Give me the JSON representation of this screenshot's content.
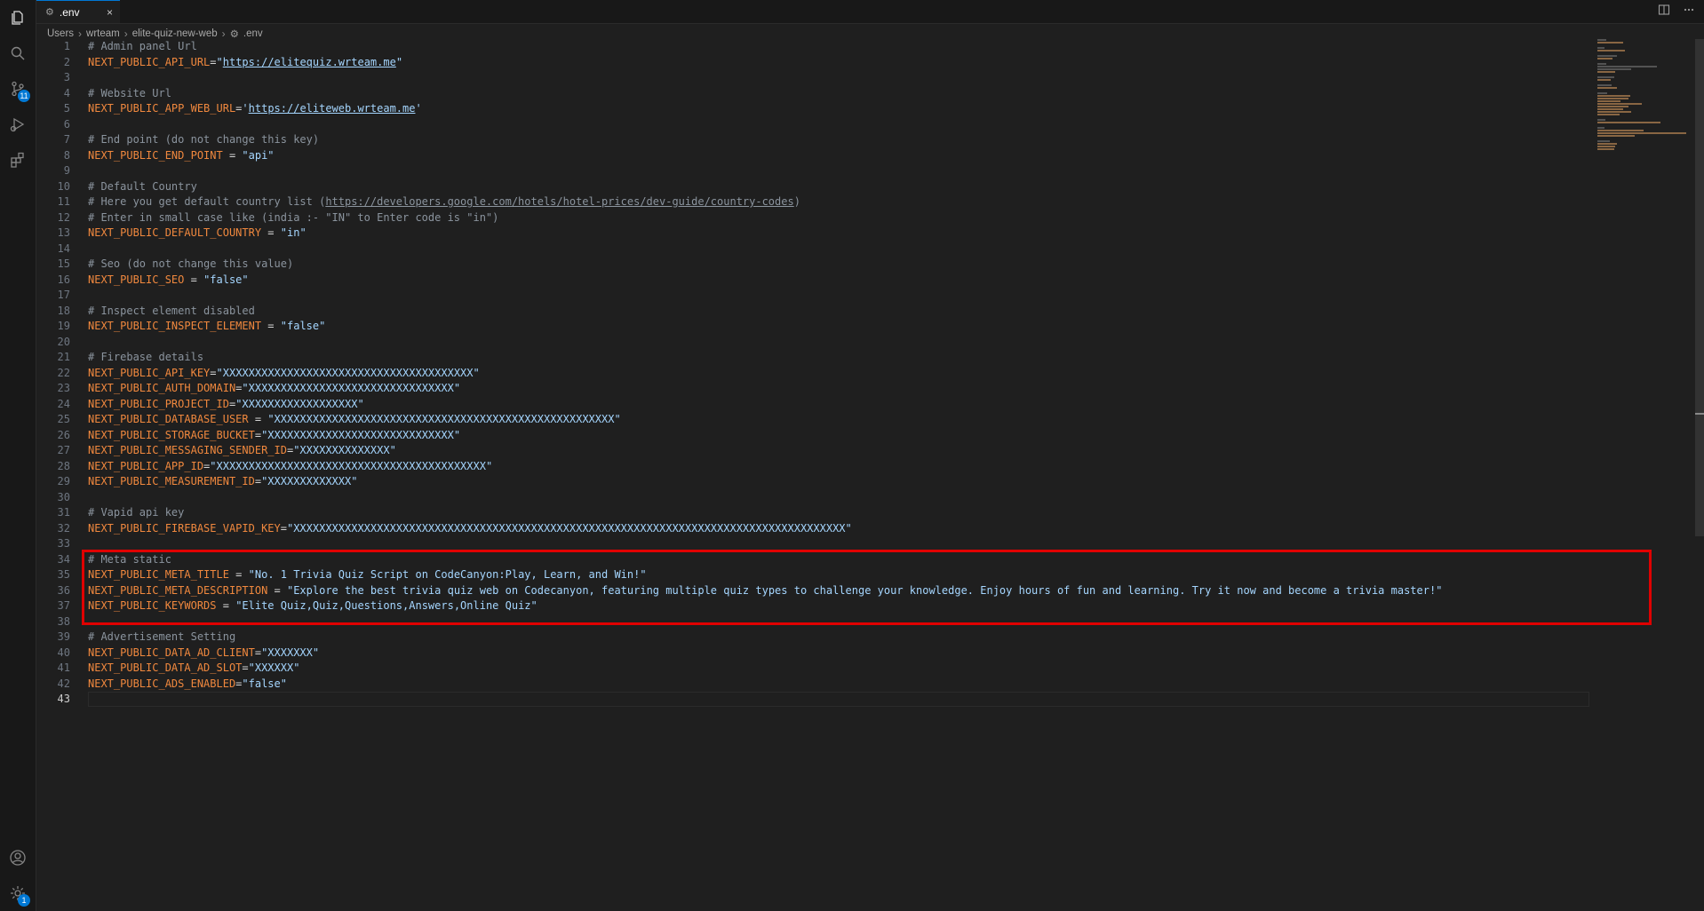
{
  "tab": {
    "label": ".env",
    "close": "×"
  },
  "breadcrumb": [
    "Users",
    "wrteam",
    "elite-quiz-new-web",
    ".env"
  ],
  "activity": {
    "source_control_badge": "11",
    "settings_badge": "1"
  },
  "lines": [
    {
      "n": "1",
      "parts": [
        [
          "cm",
          "# Admin panel Url"
        ]
      ]
    },
    {
      "n": "2",
      "parts": [
        [
          "key",
          "NEXT_PUBLIC_API_URL"
        ],
        [
          "eq",
          "="
        ],
        [
          "str",
          "\""
        ],
        [
          "str url",
          "https://elitequiz.wrteam.me"
        ],
        [
          "str",
          "\""
        ]
      ]
    },
    {
      "n": "3",
      "parts": []
    },
    {
      "n": "4",
      "parts": [
        [
          "cm",
          "# Website Url"
        ]
      ]
    },
    {
      "n": "5",
      "parts": [
        [
          "key",
          "NEXT_PUBLIC_APP_WEB_URL"
        ],
        [
          "eq",
          "="
        ],
        [
          "str",
          "'"
        ],
        [
          "str url",
          "https://eliteweb.wrteam.me"
        ],
        [
          "str",
          "'"
        ]
      ]
    },
    {
      "n": "6",
      "parts": []
    },
    {
      "n": "7",
      "parts": [
        [
          "cm",
          "# End point (do not change this key)"
        ]
      ]
    },
    {
      "n": "8",
      "parts": [
        [
          "key",
          "NEXT_PUBLIC_END_POINT"
        ],
        [
          "eq",
          " = "
        ],
        [
          "str",
          "\"api\""
        ]
      ]
    },
    {
      "n": "9",
      "parts": []
    },
    {
      "n": "10",
      "parts": [
        [
          "cm",
          "# Default Country"
        ]
      ]
    },
    {
      "n": "11",
      "parts": [
        [
          "cm",
          "# Here you get default country list ("
        ],
        [
          "cm url",
          "https://developers.google.com/hotels/hotel-prices/dev-guide/country-codes"
        ],
        [
          "cm",
          ")"
        ]
      ]
    },
    {
      "n": "12",
      "parts": [
        [
          "cm",
          "# Enter in small case like (india :- \"IN\" to Enter code is \"in\")"
        ]
      ]
    },
    {
      "n": "13",
      "parts": [
        [
          "key",
          "NEXT_PUBLIC_DEFAULT_COUNTRY"
        ],
        [
          "eq",
          " = "
        ],
        [
          "str",
          "\"in\""
        ]
      ]
    },
    {
      "n": "14",
      "parts": []
    },
    {
      "n": "15",
      "parts": [
        [
          "cm",
          "# Seo (do not change this value)"
        ]
      ]
    },
    {
      "n": "16",
      "parts": [
        [
          "key",
          "NEXT_PUBLIC_SEO"
        ],
        [
          "eq",
          " = "
        ],
        [
          "str",
          "\"false\""
        ]
      ]
    },
    {
      "n": "17",
      "parts": []
    },
    {
      "n": "18",
      "parts": [
        [
          "cm",
          "# Inspect element disabled"
        ]
      ]
    },
    {
      "n": "19",
      "parts": [
        [
          "key",
          "NEXT_PUBLIC_INSPECT_ELEMENT"
        ],
        [
          "eq",
          " = "
        ],
        [
          "str",
          "\"false\""
        ]
      ]
    },
    {
      "n": "20",
      "parts": []
    },
    {
      "n": "21",
      "parts": [
        [
          "cm",
          "# Firebase details"
        ]
      ]
    },
    {
      "n": "22",
      "parts": [
        [
          "key",
          "NEXT_PUBLIC_API_KEY"
        ],
        [
          "eq",
          "="
        ],
        [
          "str",
          "\"XXXXXXXXXXXXXXXXXXXXXXXXXXXXXXXXXXXXXXX\""
        ]
      ]
    },
    {
      "n": "23",
      "parts": [
        [
          "key",
          "NEXT_PUBLIC_AUTH_DOMAIN"
        ],
        [
          "eq",
          "="
        ],
        [
          "str",
          "\"XXXXXXXXXXXXXXXXXXXXXXXXXXXXXXXX\""
        ]
      ]
    },
    {
      "n": "24",
      "parts": [
        [
          "key",
          "NEXT_PUBLIC_PROJECT_ID"
        ],
        [
          "eq",
          "="
        ],
        [
          "str",
          "\"XXXXXXXXXXXXXXXXXX\""
        ]
      ]
    },
    {
      "n": "25",
      "parts": [
        [
          "key",
          "NEXT_PUBLIC_DATABASE_USER"
        ],
        [
          "eq",
          " = "
        ],
        [
          "str",
          "\"XXXXXXXXXXXXXXXXXXXXXXXXXXXXXXXXXXXXXXXXXXXXXXXXXXXXX\""
        ]
      ]
    },
    {
      "n": "26",
      "parts": [
        [
          "key",
          "NEXT_PUBLIC_STORAGE_BUCKET"
        ],
        [
          "eq",
          "="
        ],
        [
          "str",
          "\"XXXXXXXXXXXXXXXXXXXXXXXXXXXXX\""
        ]
      ]
    },
    {
      "n": "27",
      "parts": [
        [
          "key",
          "NEXT_PUBLIC_MESSAGING_SENDER_ID"
        ],
        [
          "eq",
          "="
        ],
        [
          "str",
          "\"XXXXXXXXXXXXXX\""
        ]
      ]
    },
    {
      "n": "28",
      "parts": [
        [
          "key",
          "NEXT_PUBLIC_APP_ID"
        ],
        [
          "eq",
          "="
        ],
        [
          "str",
          "\"XXXXXXXXXXXXXXXXXXXXXXXXXXXXXXXXXXXXXXXXXX\""
        ]
      ]
    },
    {
      "n": "29",
      "parts": [
        [
          "key",
          "NEXT_PUBLIC_MEASUREMENT_ID"
        ],
        [
          "eq",
          "="
        ],
        [
          "str",
          "\"XXXXXXXXXXXXX\""
        ]
      ]
    },
    {
      "n": "30",
      "parts": []
    },
    {
      "n": "31",
      "parts": [
        [
          "cm",
          "# Vapid api key"
        ]
      ]
    },
    {
      "n": "32",
      "parts": [
        [
          "key",
          "NEXT_PUBLIC_FIREBASE_VAPID_KEY"
        ],
        [
          "eq",
          "="
        ],
        [
          "str",
          "\"XXXXXXXXXXXXXXXXXXXXXXXXXXXXXXXXXXXXXXXXXXXXXXXXXXXXXXXXXXXXXXXXXXXXXXXXXXXXXXXXXXXXXX\""
        ]
      ]
    },
    {
      "n": "33",
      "parts": []
    },
    {
      "n": "34",
      "parts": [
        [
          "cm",
          "# Meta static"
        ]
      ]
    },
    {
      "n": "35",
      "parts": [
        [
          "key",
          "NEXT_PUBLIC_META_TITLE"
        ],
        [
          "eq",
          " = "
        ],
        [
          "str",
          "\"No. 1 Trivia Quiz Script on CodeCanyon:Play, Learn, and Win!\""
        ]
      ]
    },
    {
      "n": "36",
      "parts": [
        [
          "key",
          "NEXT_PUBLIC_META_DESCRIPTION"
        ],
        [
          "eq",
          " = "
        ],
        [
          "str",
          "\"Explore the best trivia quiz web on Codecanyon, featuring multiple quiz types to challenge your knowledge. Enjoy hours of fun and learning. Try it now and become a trivia master!\""
        ]
      ]
    },
    {
      "n": "37",
      "parts": [
        [
          "key",
          "NEXT_PUBLIC_KEYWORDS"
        ],
        [
          "eq",
          " = "
        ],
        [
          "str",
          "\"Elite Quiz,Quiz,Questions,Answers,Online Quiz\""
        ]
      ]
    },
    {
      "n": "38",
      "parts": []
    },
    {
      "n": "39",
      "parts": [
        [
          "cm",
          "# Advertisement Setting"
        ]
      ]
    },
    {
      "n": "40",
      "parts": [
        [
          "key",
          "NEXT_PUBLIC_DATA_AD_CLIENT"
        ],
        [
          "eq",
          "="
        ],
        [
          "str",
          "\"XXXXXXX\""
        ]
      ]
    },
    {
      "n": "41",
      "parts": [
        [
          "key",
          "NEXT_PUBLIC_DATA_AD_SLOT"
        ],
        [
          "eq",
          "="
        ],
        [
          "str",
          "\"XXXXXX\""
        ]
      ]
    },
    {
      "n": "42",
      "parts": [
        [
          "key",
          "NEXT_PUBLIC_ADS_ENABLED"
        ],
        [
          "eq",
          "="
        ],
        [
          "str",
          "\"false\""
        ]
      ]
    },
    {
      "n": "43",
      "parts": [],
      "current": true
    }
  ],
  "colors": {
    "comment": "#8b949e",
    "key": "#f0883e",
    "string": "#a5d6ff",
    "highlight": "#e00000",
    "accent": "#0078d4"
  }
}
